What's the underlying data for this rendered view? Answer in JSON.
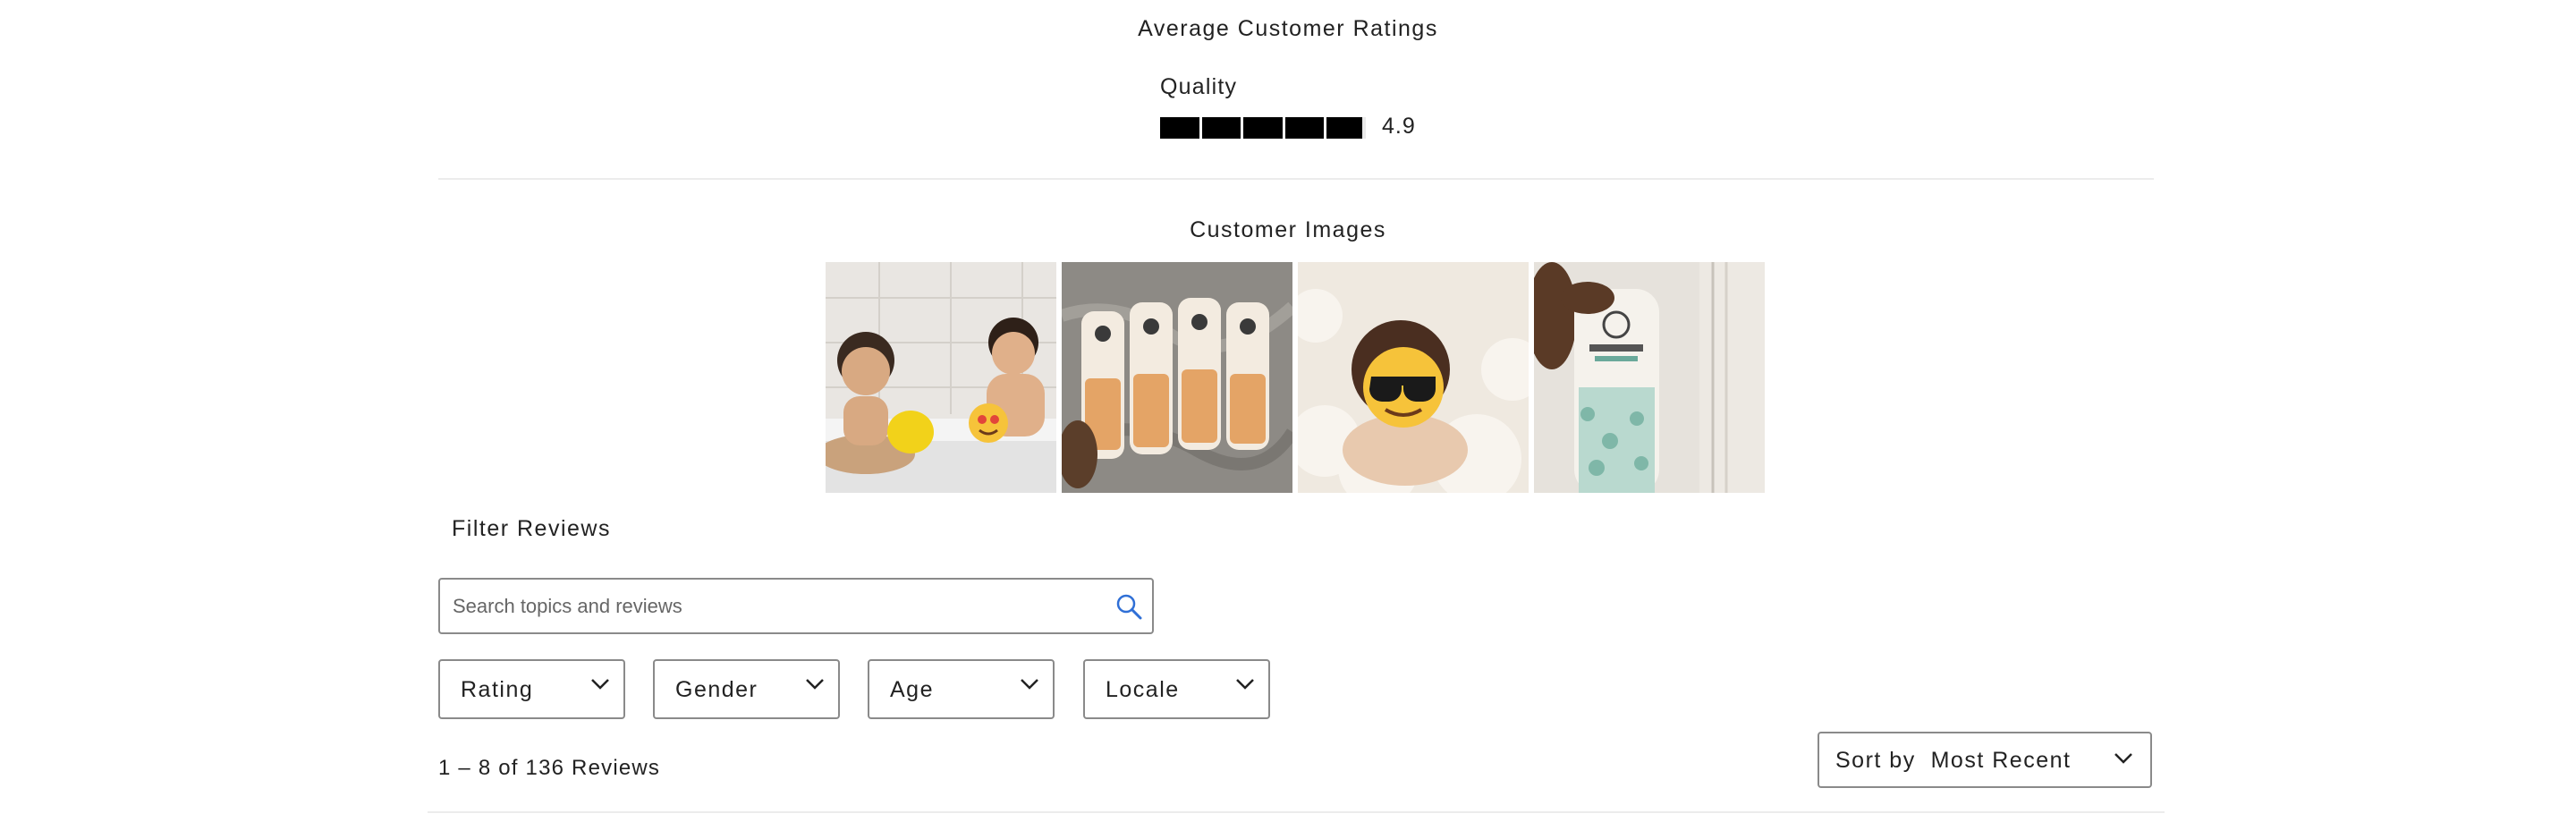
{
  "ratings": {
    "title": "Average Customer Ratings",
    "quality_label": "Quality",
    "quality_value": "4.9",
    "quality_score": 4.9,
    "quality_max": 5
  },
  "customer_images": {
    "title": "Customer Images",
    "images": [
      {
        "name": "customer-image-kids-bath"
      },
      {
        "name": "customer-image-four-bottles"
      },
      {
        "name": "customer-image-baby-bubbles"
      },
      {
        "name": "customer-image-bottle-in-hand"
      }
    ]
  },
  "filters": {
    "title": "Filter Reviews",
    "search_placeholder": "Search topics and reviews",
    "dropdowns": [
      "Rating",
      "Gender",
      "Age",
      "Locale"
    ]
  },
  "results": {
    "count_text": "1 – 8 of 136 Reviews"
  },
  "sort": {
    "label": "Sort by",
    "value": "Most Recent"
  },
  "icons": {
    "search": "search-icon",
    "chevron": "chevron-down-icon"
  },
  "colors": {
    "bar_fill": "#000000",
    "border": "#8a8a8a",
    "search_icon": "#2f6fd6"
  }
}
